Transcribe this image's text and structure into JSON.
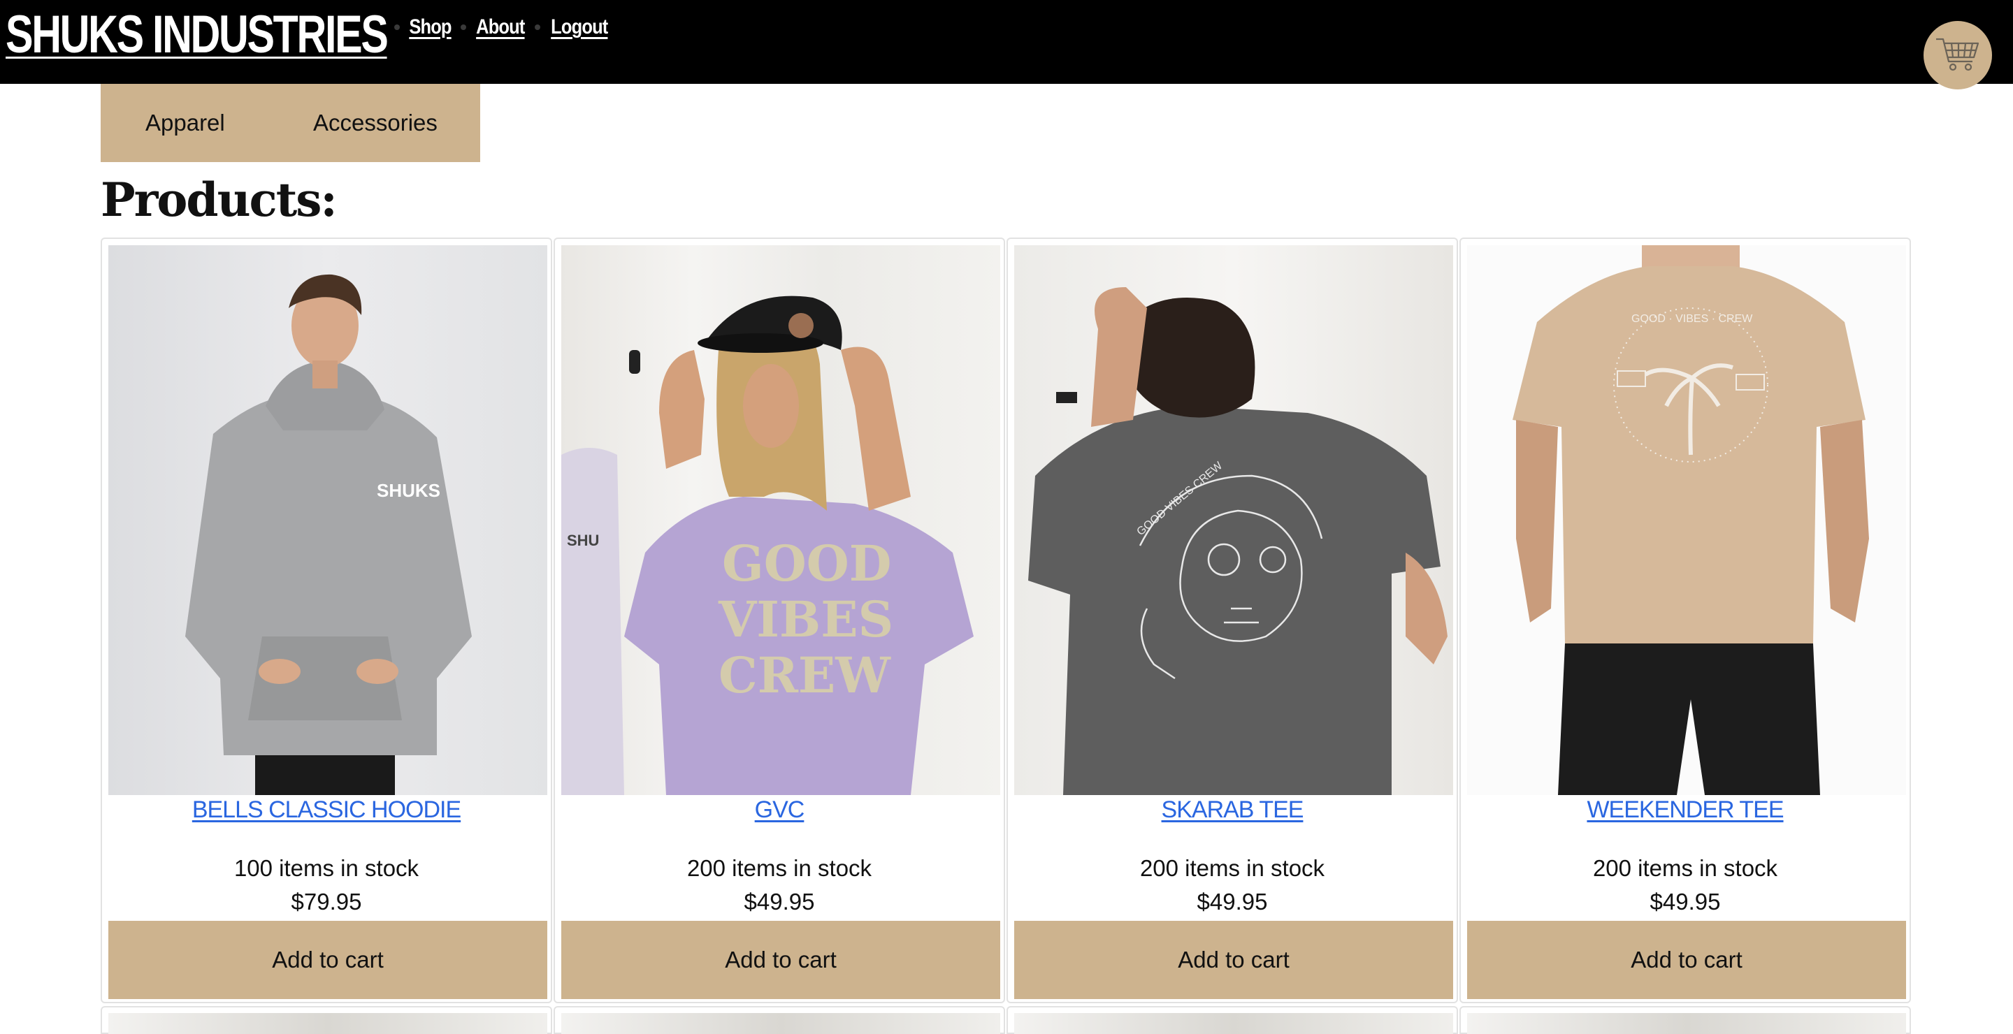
{
  "navbar": {
    "brand": "SHUKS INDUSTRIES",
    "links": [
      "Shop",
      "About",
      "Logout"
    ],
    "cart_icon": "shopping-cart-icon",
    "background": "#000000"
  },
  "categories": {
    "items": [
      "Apparel",
      "Accessories"
    ],
    "background": "#cdb38e"
  },
  "heading": "Products:",
  "products": [
    {
      "name": "BELLS CLASSIC HOODIE",
      "stock": "100 items in stock",
      "price": "$79.95",
      "button": "Add to cart",
      "image": "grey-hoodie-photo"
    },
    {
      "name": "GVC",
      "stock": "200 items in stock",
      "price": "$49.95",
      "button": "Add to cart",
      "image": "lavender-tee-cap-photo"
    },
    {
      "name": "SKARAB TEE",
      "stock": "200 items in stock",
      "price": "$49.95",
      "button": "Add to cart",
      "image": "charcoal-tee-skull-photo"
    },
    {
      "name": "WEEKENDER TEE",
      "stock": "200 items in stock",
      "price": "$49.95",
      "button": "Add to cart",
      "image": "sand-tee-palm-photo"
    }
  ],
  "colors": {
    "accent": "#cdb38e",
    "link": "#2a66e0",
    "text": "#111111"
  }
}
